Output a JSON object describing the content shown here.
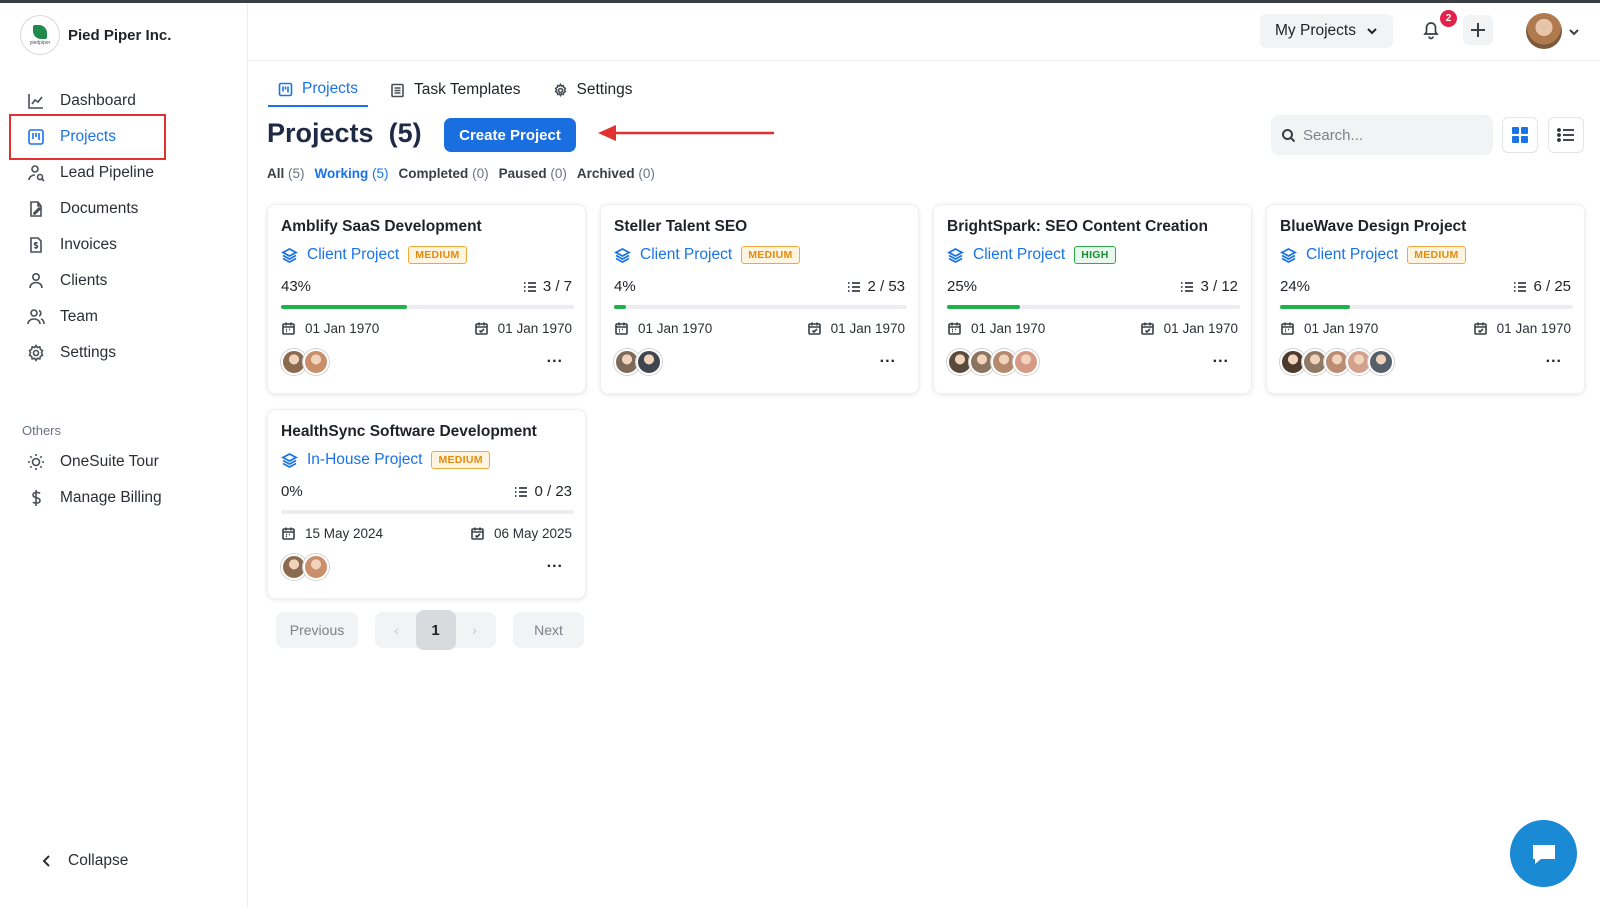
{
  "brand": {
    "name": "Pied Piper Inc.",
    "logo_text": "piedpiper"
  },
  "sidebar": {
    "items": [
      {
        "label": "Dashboard",
        "icon": "chart-line-icon"
      },
      {
        "label": "Projects",
        "icon": "kanban-icon",
        "active": true
      },
      {
        "label": "Lead Pipeline",
        "icon": "user-search-icon"
      },
      {
        "label": "Documents",
        "icon": "document-edit-icon"
      },
      {
        "label": "Invoices",
        "icon": "invoice-dollar-icon"
      },
      {
        "label": "Clients",
        "icon": "user-icon"
      },
      {
        "label": "Team",
        "icon": "users-icon"
      },
      {
        "label": "Settings",
        "icon": "gear-icon"
      }
    ],
    "others_label": "Others",
    "others": [
      {
        "label": "OneSuite Tour",
        "icon": "sun-icon"
      },
      {
        "label": "Manage Billing",
        "icon": "dollar-icon"
      }
    ],
    "collapse_label": "Collapse"
  },
  "header": {
    "scope_label": "My Projects",
    "notification_count": "2"
  },
  "tabs": [
    {
      "label": "Projects",
      "active": true
    },
    {
      "label": "Task Templates"
    },
    {
      "label": "Settings"
    }
  ],
  "page": {
    "title": "Projects",
    "title_count": "(5)",
    "create_label": "Create Project",
    "search_placeholder": "Search..."
  },
  "filters": [
    {
      "label": "All",
      "count": "(5)"
    },
    {
      "label": "Working",
      "count": "(5)",
      "active": true
    },
    {
      "label": "Completed",
      "count": "(0)"
    },
    {
      "label": "Paused",
      "count": "(0)"
    },
    {
      "label": "Archived",
      "count": "(0)"
    }
  ],
  "projects": [
    {
      "title": "Amblify SaaS Development",
      "type": "Client Project",
      "priority": "MEDIUM",
      "percent": "43%",
      "progress": 0.43,
      "tasks": "3 / 7",
      "start": "01 Jan 1970",
      "due": "01 Jan 1970"
    },
    {
      "title": "Steller Talent SEO",
      "type": "Client Project",
      "priority": "MEDIUM",
      "percent": "4%",
      "progress": 0.04,
      "tasks": "2 / 53",
      "start": "01 Jan 1970",
      "due": "01 Jan 1970"
    },
    {
      "title": "BrightSpark: SEO Content Creation",
      "type": "Client Project",
      "priority": "HIGH",
      "percent": "25%",
      "progress": 0.25,
      "tasks": "3 / 12",
      "start": "01 Jan 1970",
      "due": "01 Jan 1970"
    },
    {
      "title": "BlueWave Design Project",
      "type": "Client Project",
      "priority": "MEDIUM",
      "percent": "24%",
      "progress": 0.24,
      "tasks": "6 / 25",
      "start": "01 Jan 1970",
      "due": "01 Jan 1970"
    },
    {
      "title": "HealthSync Software Development",
      "type": "In-House Project",
      "priority": "MEDIUM",
      "percent": "0%",
      "progress": 0,
      "tasks": "0 / 23",
      "start": "15 May 2024",
      "due": "06 May 2025"
    }
  ],
  "more_label": "...",
  "pagination": {
    "previous": "Previous",
    "page": "1",
    "next": "Next",
    "prev_chevron": "‹",
    "next_chevron": "›"
  },
  "colors": {
    "accent": "#1a73e8",
    "primary_button": "#1a6fe0",
    "progress": "#1fb24a",
    "annotation_red": "#e03030",
    "chat": "#1a8ad4"
  }
}
